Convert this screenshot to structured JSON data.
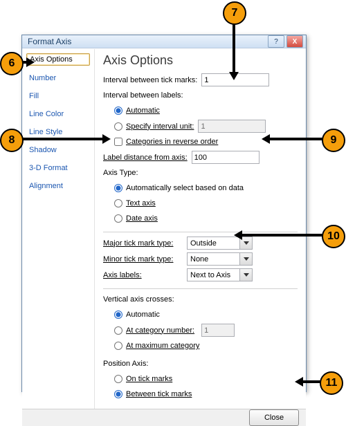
{
  "callouts": {
    "c6": "6",
    "c7": "7",
    "c8": "8",
    "c9": "9",
    "c10": "10",
    "c11": "11"
  },
  "dialog": {
    "title": "Format Axis",
    "help_glyph": "?",
    "close_glyph": "X"
  },
  "sidebar": {
    "items": [
      {
        "label": "Axis Options",
        "active": true
      },
      {
        "label": "Number"
      },
      {
        "label": "Fill"
      },
      {
        "label": "Line Color"
      },
      {
        "label": "Line Style"
      },
      {
        "label": "Shadow"
      },
      {
        "label": "3-D Format"
      },
      {
        "label": "Alignment"
      }
    ]
  },
  "main": {
    "heading": "Axis Options",
    "interval_tick_label": "Interval between tick marks:",
    "interval_tick_value": "1",
    "interval_labels_label": "Interval between labels:",
    "auto_label": "Automatic",
    "specify_unit_label": "Specify interval unit:",
    "specify_unit_value": "1",
    "reverse_label": "Categories in reverse order",
    "label_distance_label": "Label distance from axis:",
    "label_distance_value": "100",
    "axis_type_label": "Axis Type:",
    "axis_type_auto": "Automatically select based on data",
    "axis_type_text": "Text axis",
    "axis_type_date": "Date axis",
    "major_tick_label": "Major tick mark type:",
    "major_tick_value": "Outside",
    "minor_tick_label": "Minor tick mark type:",
    "minor_tick_value": "None",
    "axis_labels_label": "Axis labels:",
    "axis_labels_value": "Next to Axis",
    "vert_cross_label": "Vertical axis crosses:",
    "vert_cross_auto": "Automatic",
    "vert_cross_cat": "At category number:",
    "vert_cross_cat_value": "1",
    "vert_cross_max": "At maximum category",
    "position_axis_label": "Position Axis:",
    "position_on": "On tick marks",
    "position_between": "Between tick marks"
  },
  "footer": {
    "close": "Close"
  }
}
